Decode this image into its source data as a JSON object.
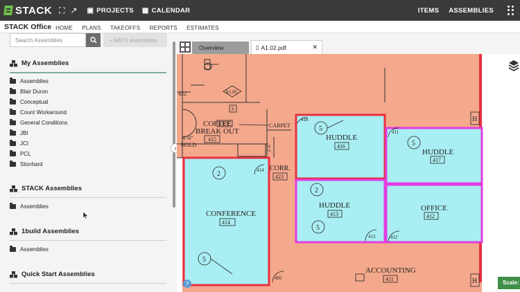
{
  "app": {
    "logo": "STACK",
    "nav": [
      "PROJECTS",
      "CALENDAR"
    ],
    "right_nav": [
      "ITEMS",
      "ASSEMBLIES"
    ]
  },
  "subheader": {
    "title": "STACK Office",
    "nav": [
      "HOME",
      "PLANS",
      "TAKEOFFS",
      "REPORTS",
      "ESTIMATES"
    ]
  },
  "left_panel": {
    "search_placeholder": "Search Assemblies",
    "add_button": "+ Add 0 assemblies",
    "sections": [
      {
        "title": "My Assemblies",
        "folders": [
          "Assemblies",
          "Blair Duron",
          "Conceptual",
          "Count Workaround",
          "General Conditions",
          "JBI",
          "JCI",
          "PCL",
          "Stonhard"
        ]
      },
      {
        "title": "STACK Assemblies",
        "folders": [
          "Assemblies"
        ]
      },
      {
        "title": "1build Assemblies",
        "folders": [
          "Assemblies"
        ]
      },
      {
        "title": "Quick Start Assemblies",
        "folders": []
      }
    ]
  },
  "tabs": {
    "overview": "Overview",
    "file": "A1.02.pdf"
  },
  "plan": {
    "rooms": [
      {
        "name": "COFFEE",
        "number": ""
      },
      {
        "name": "BREAK OUT",
        "number": "415"
      },
      {
        "name": "HUDDLE",
        "number": "416"
      },
      {
        "name": "HUDDLE",
        "number": "417"
      },
      {
        "name": "HUDDLE",
        "number": "413"
      },
      {
        "name": "OFFICE",
        "number": "412"
      },
      {
        "name": "CONFERENCE",
        "number": "414"
      },
      {
        "name": "CORR.",
        "number": "423"
      },
      {
        "name": "ACCOUNTING",
        "number": "411"
      }
    ],
    "labels": [
      "LVT",
      "CARPET",
      "4'-0\"",
      "HOLD",
      "2'-6\"",
      "A1.05",
      "422",
      "3",
      "418",
      "411"
    ],
    "door_tags": [
      "414",
      "416",
      "411",
      "413",
      "412",
      "405"
    ],
    "keynotes": [
      "5",
      "5",
      "5",
      "5",
      "5",
      "2",
      "2"
    ]
  },
  "scale_label": "Scale:",
  "colors": {
    "topbar": "#3a3a38",
    "brand_green": "#6fbf4b",
    "area_orange": "#f4a88c",
    "area_cyan": "#a9eef2",
    "outline_red": "#e8303f",
    "outline_magenta": "#e13ee0"
  }
}
